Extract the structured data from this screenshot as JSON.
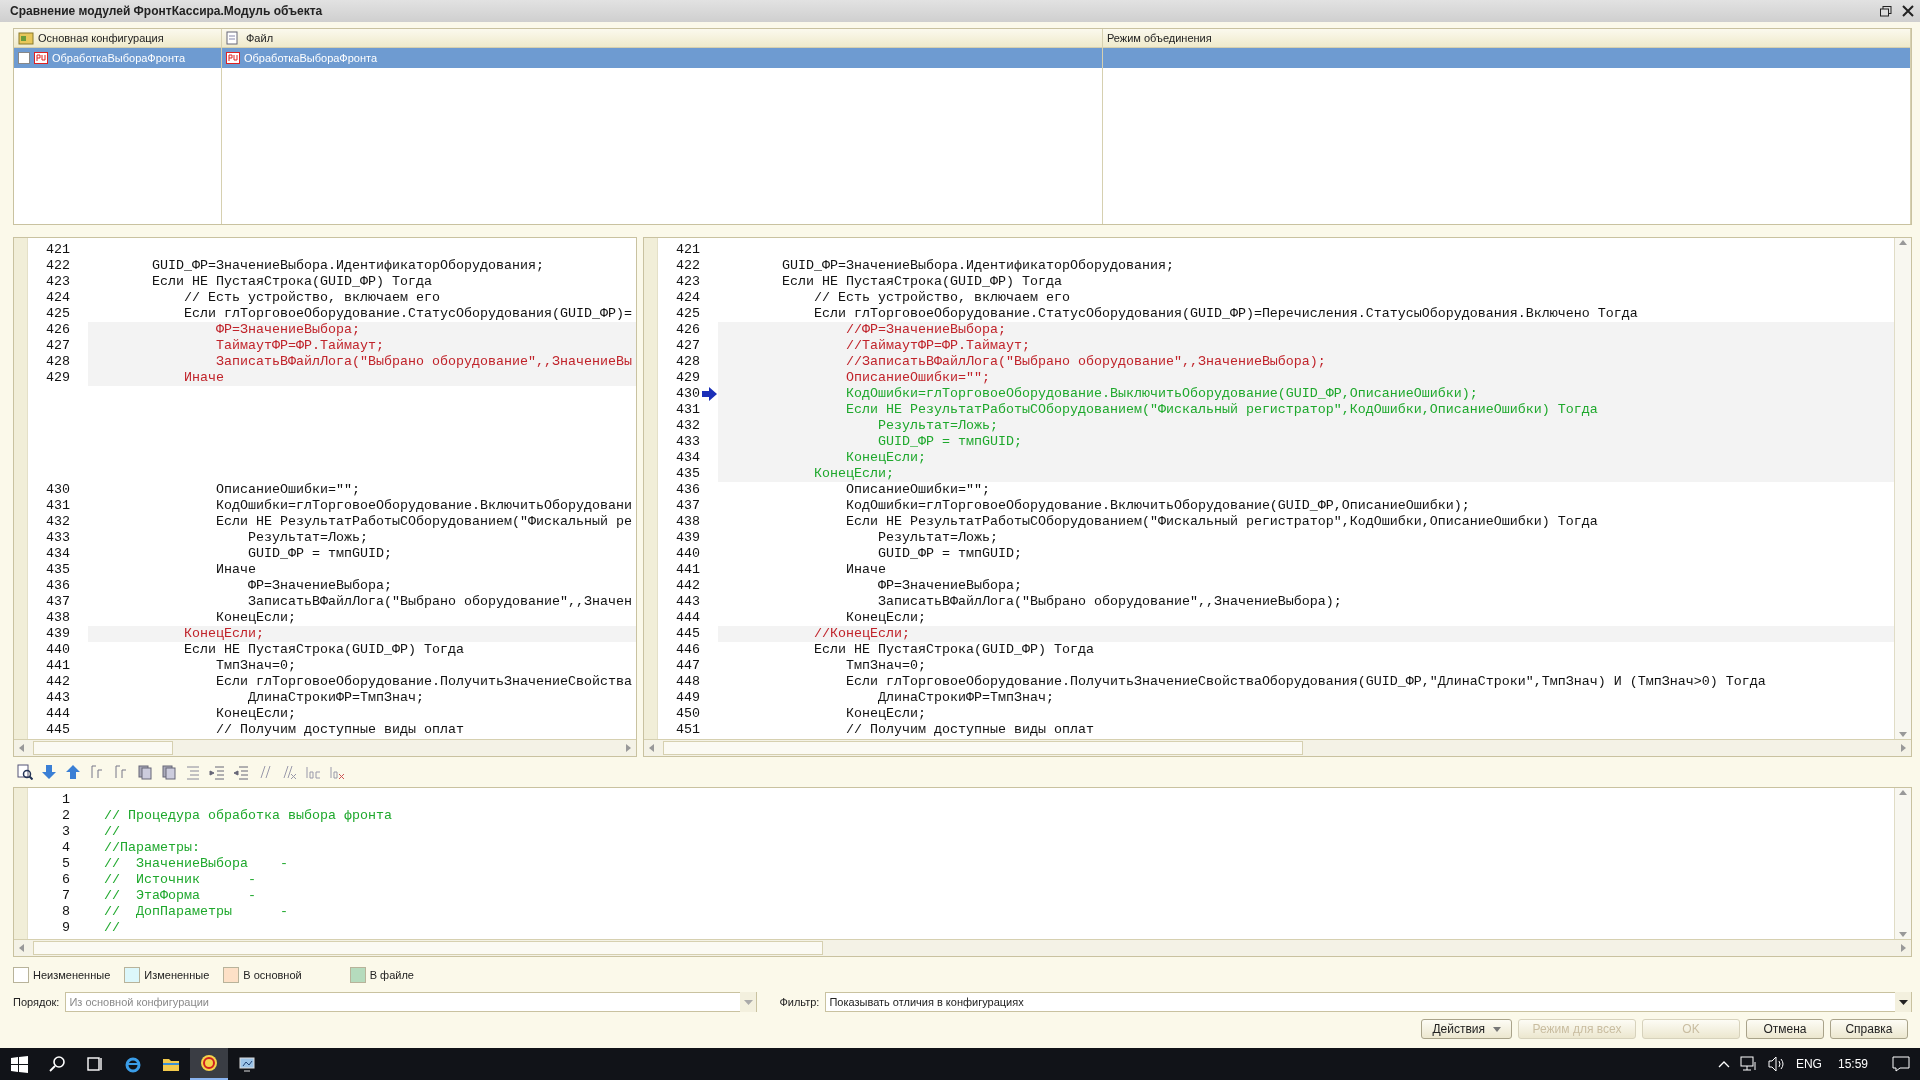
{
  "window": {
    "title": "Сравнение модулей ФронтКассира.Модуль объекта"
  },
  "objects_table": {
    "columns": [
      "Основная конфигурация",
      "Файл",
      "Режим объединения"
    ],
    "rows": [
      {
        "selected": true,
        "checked": false,
        "cells": [
          "ОбработкаВыбораФронта",
          "ОбработкаВыбораФронта"
        ]
      }
    ]
  },
  "left_pane": {
    "lines": [
      {
        "num": "421",
        "kind": "normal",
        "highlight": false
      },
      {
        "num": "422",
        "text": "        GUID_ФР=ЗначениеВыбора.ИдентификаторОборудования;",
        "kind": "normal",
        "highlight": false
      },
      {
        "num": "423",
        "text": "        Если НЕ ПустаяСтрока(GUID_ФР) Тогда",
        "kind": "normal",
        "highlight": false
      },
      {
        "num": "424",
        "text": "            // Есть устройство, включаем его",
        "kind": "normal",
        "highlight": false
      },
      {
        "num": "425",
        "text": "            Если глТорговоеОборудование.СтатусОборудования(GUID_ФР)=",
        "kind": "normal",
        "highlight": false
      },
      {
        "num": "426",
        "text": "                ФР=ЗначениеВыбора;",
        "kind": "changed",
        "highlight": true
      },
      {
        "num": "427",
        "text": "                ТаймаутФР=ФР.Таймаут;",
        "kind": "changed",
        "highlight": true
      },
      {
        "num": "428",
        "text": "                ЗаписатьВФайлЛога(\"Выбрано оборудование\",,ЗначениеВы",
        "kind": "changed",
        "highlight": true
      },
      {
        "num": "429",
        "text": "            Иначе",
        "kind": "changed",
        "highlight": true
      },
      {
        "kind": "gap"
      },
      {
        "num": "430",
        "text": "                ОписаниеОшибки=\"\";",
        "kind": "normal",
        "highlight": false
      },
      {
        "num": "431",
        "text": "                КодОшибки=глТорговоеОборудование.ВключитьОборудовани",
        "kind": "normal",
        "highlight": false
      },
      {
        "num": "432",
        "text": "                Если НЕ РезультатРаботыСОборудованием(\"Фискальный ре",
        "kind": "normal",
        "highlight": false
      },
      {
        "num": "433",
        "text": "                    Результат=Ложь;",
        "kind": "normal",
        "highlight": false
      },
      {
        "num": "434",
        "text": "                    GUID_ФР = тмпGUID;",
        "kind": "normal",
        "highlight": false
      },
      {
        "num": "435",
        "text": "                Иначе",
        "kind": "normal",
        "highlight": false
      },
      {
        "num": "436",
        "text": "                    ФР=ЗначениеВыбора;",
        "kind": "normal",
        "highlight": false
      },
      {
        "num": "437",
        "text": "                    ЗаписатьВФайлЛога(\"Выбрано оборудование\",,Значен",
        "kind": "normal",
        "highlight": false
      },
      {
        "num": "438",
        "text": "                КонецЕсли;",
        "kind": "normal",
        "highlight": false
      },
      {
        "num": "439",
        "text": "            КонецЕсли;",
        "kind": "changed",
        "highlight": true
      },
      {
        "num": "440",
        "text": "            Если НЕ ПустаяСтрока(GUID_ФР) Тогда",
        "kind": "normal",
        "highlight": false
      },
      {
        "num": "441",
        "text": "                ТмпЗнач=0;",
        "kind": "normal",
        "highlight": false
      },
      {
        "num": "442",
        "text": "                Если глТорговоеОборудование.ПолучитьЗначениеСвойства",
        "kind": "normal",
        "highlight": false
      },
      {
        "num": "443",
        "text": "                    ДлинаСтрокиФР=ТмпЗнач;",
        "kind": "normal",
        "highlight": false
      },
      {
        "num": "444",
        "text": "                КонецЕсли;",
        "kind": "normal",
        "highlight": false
      },
      {
        "num": "445",
        "text": "                // Получим доступные виды оплат",
        "kind": "normal",
        "highlight": false
      }
    ]
  },
  "right_pane": {
    "lines": [
      {
        "num": "421",
        "kind": "normal",
        "highlight": false
      },
      {
        "num": "422",
        "text": "        GUID_ФР=ЗначениеВыбора.ИдентификаторОборудования;",
        "kind": "normal",
        "highlight": false
      },
      {
        "num": "423",
        "text": "        Если НЕ ПустаяСтрока(GUID_ФР) Тогда",
        "kind": "normal",
        "highlight": false
      },
      {
        "num": "424",
        "text": "            // Есть устройство, включаем его",
        "kind": "normal",
        "highlight": false
      },
      {
        "num": "425",
        "text": "            Если глТорговоеОборудование.СтатусОборудования(GUID_ФР)=Перечисления.СтатусыОборудования.Включено Тогда",
        "kind": "normal",
        "highlight": false
      },
      {
        "num": "426",
        "text": "                //ФР=ЗначениеВыбора;",
        "kind": "changed",
        "highlight": true
      },
      {
        "num": "427",
        "text": "                //ТаймаутФР=ФР.Таймаут;",
        "kind": "changed",
        "highlight": true
      },
      {
        "num": "428",
        "text": "                //ЗаписатьВФайлЛога(\"Выбрано оборудование\",,ЗначениеВыбора);",
        "kind": "changed",
        "highlight": true
      },
      {
        "num": "429",
        "text": "                ОписаниеОшибки=\"\";",
        "kind": "changed",
        "highlight": true
      },
      {
        "num": "430",
        "text": "                КодОшибки=глТорговоеОборудование.ВыключитьОборудование(GUID_ФР,ОписаниеОшибки);",
        "kind": "added",
        "highlight": true,
        "current": true
      },
      {
        "num": "431",
        "text": "                Если НЕ РезультатРаботыСОборудованием(\"Фискальный регистратор\",КодОшибки,ОписаниеОшибки) Тогда",
        "kind": "added",
        "highlight": true
      },
      {
        "num": "432",
        "text": "                    Результат=Ложь;",
        "kind": "added",
        "highlight": true
      },
      {
        "num": "433",
        "text": "                    GUID_ФР = тмпGUID;",
        "kind": "added",
        "highlight": true
      },
      {
        "num": "434",
        "text": "                КонецЕсли;",
        "kind": "added",
        "highlight": true
      },
      {
        "num": "435",
        "text": "            КонецЕсли;",
        "kind": "added",
        "highlight": true
      },
      {
        "num": "436",
        "text": "                ОписаниеОшибки=\"\";",
        "kind": "normal",
        "highlight": false
      },
      {
        "num": "437",
        "text": "                КодОшибки=глТорговоеОборудование.ВключитьОборудование(GUID_ФР,ОписаниеОшибки);",
        "kind": "normal",
        "highlight": false
      },
      {
        "num": "438",
        "text": "                Если НЕ РезультатРаботыСОборудованием(\"Фискальный регистратор\",КодОшибки,ОписаниеОшибки) Тогда",
        "kind": "normal",
        "highlight": false
      },
      {
        "num": "439",
        "text": "                    Результат=Ложь;",
        "kind": "normal",
        "highlight": false
      },
      {
        "num": "440",
        "text": "                    GUID_ФР = тмпGUID;",
        "kind": "normal",
        "highlight": false
      },
      {
        "num": "441",
        "text": "                Иначе",
        "kind": "normal",
        "highlight": false
      },
      {
        "num": "442",
        "text": "                    ФР=ЗначениеВыбора;",
        "kind": "normal",
        "highlight": false
      },
      {
        "num": "443",
        "text": "                    ЗаписатьВФайлЛога(\"Выбрано оборудование\",,ЗначениеВыбора);",
        "kind": "normal",
        "highlight": false
      },
      {
        "num": "444",
        "text": "                КонецЕсли;",
        "kind": "normal",
        "highlight": false
      },
      {
        "num": "445",
        "text": "            //КонецЕсли;",
        "kind": "changed",
        "highlight": true
      },
      {
        "num": "446",
        "text": "            Если НЕ ПустаяСтрока(GUID_ФР) Тогда",
        "kind": "normal",
        "highlight": false
      },
      {
        "num": "447",
        "text": "                ТмпЗнач=0;",
        "kind": "normal",
        "highlight": false
      },
      {
        "num": "448",
        "text": "                Если глТорговоеОборудование.ПолучитьЗначениеСвойстваОборудования(GUID_ФР,\"ДлинаСтроки\",ТмпЗнач) И (ТмпЗнач>0) Тогда",
        "kind": "normal",
        "highlight": false
      },
      {
        "num": "449",
        "text": "                    ДлинаСтрокиФР=ТмпЗнач;",
        "kind": "normal",
        "highlight": false
      },
      {
        "num": "450",
        "text": "                КонецЕсли;",
        "kind": "normal",
        "highlight": false
      },
      {
        "num": "451",
        "text": "                // Получим доступные виды оплат",
        "kind": "normal",
        "highlight": false
      }
    ]
  },
  "bottom_pane": {
    "lines": [
      {
        "num": "1",
        "kind": "added",
        "highlight": false
      },
      {
        "num": "2",
        "text": "  // Процедура обработка выбора фронта",
        "kind": "added",
        "highlight": false
      },
      {
        "num": "3",
        "text": "  //",
        "kind": "added",
        "highlight": false
      },
      {
        "num": "4",
        "text": "  //Параметры:",
        "kind": "added",
        "highlight": false
      },
      {
        "num": "5",
        "text": "  //  ЗначениеВыбора    -",
        "kind": "added",
        "highlight": false
      },
      {
        "num": "6",
        "text": "  //  Источник      -",
        "kind": "added",
        "highlight": false
      },
      {
        "num": "7",
        "text": "  //  ЭтаФорма      -",
        "kind": "added",
        "highlight": false
      },
      {
        "num": "8",
        "text": "  //  ДопПараметры      -",
        "kind": "added",
        "highlight": false
      },
      {
        "num": "9",
        "text": "  //",
        "kind": "added",
        "highlight": false
      }
    ]
  },
  "legend": [
    {
      "label": "Неизмененные",
      "color": "#ffffff"
    },
    {
      "label": "Измененные",
      "color": "#dcf7fa"
    },
    {
      "label": "В основной",
      "color": "#fde0c6"
    },
    {
      "label": "В файле",
      "color": "#b5dbbd"
    }
  ],
  "order": {
    "label": "Порядок:",
    "value": "Из основной конфигурации",
    "disabled": true
  },
  "filter": {
    "label": "Фильтр:",
    "value": "Показывать отличия в конфигурациях",
    "disabled": false
  },
  "buttons": [
    {
      "label": "Действия",
      "kind": "menu",
      "disabled": false
    },
    {
      "label": "Режим для всех",
      "kind": "plain",
      "disabled": true
    },
    {
      "label": "OK",
      "kind": "plain",
      "disabled": true
    },
    {
      "label": "Отмена",
      "kind": "plain",
      "disabled": false
    },
    {
      "label": "Справка",
      "kind": "plain",
      "disabled": false
    }
  ],
  "taskbar": {
    "language": "ENG",
    "time": "15:59"
  }
}
